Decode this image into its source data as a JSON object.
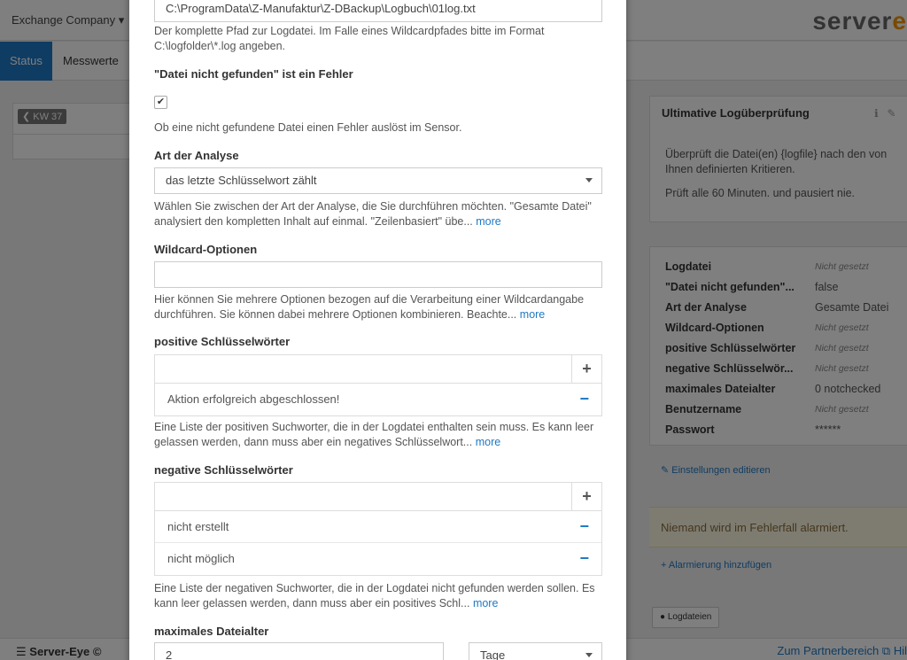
{
  "background": {
    "company_selector": "Exchange Company",
    "logo_main": "server",
    "logo_accent": "e",
    "tabs": [
      "Status",
      "Messwerte"
    ],
    "week_button": "KW 37",
    "card": {
      "title": "Ultimative Logüberprüfung",
      "description": "Überprüft die Datei(en) {logfile} nach den von Ihnen definierten Kritieren.",
      "schedule": "Prüft alle 60 Minuten. und pausiert nie."
    },
    "properties": [
      {
        "key": "Logdatei",
        "value": "Nicht gesetzt",
        "unset": true
      },
      {
        "key": "\"Datei nicht gefunden\"...",
        "value": "false",
        "unset": false
      },
      {
        "key": "Art der Analyse",
        "value": "Gesamte Datei",
        "unset": false
      },
      {
        "key": "Wildcard-Optionen",
        "value": "Nicht gesetzt",
        "unset": true
      },
      {
        "key": "positive Schlüsselwörter",
        "value": "Nicht gesetzt",
        "unset": true
      },
      {
        "key": "negative Schlüsselwör...",
        "value": "Nicht gesetzt",
        "unset": true
      },
      {
        "key": "maximales Dateialter",
        "value": "0 notchecked",
        "unset": false
      },
      {
        "key": "Benutzername",
        "value": "Nicht gesetzt",
        "unset": true
      },
      {
        "key": "Passwort",
        "value": "******",
        "unset": false
      }
    ],
    "edit_settings_link": "Einstellungen editieren",
    "alert_text": "Niemand wird im Fehlerfall alarmiert.",
    "add_alert_link": "Alarmierung hinzufügen",
    "tag_button": "Logdateien",
    "footer_brand": "Server-Eye ©",
    "footer_partner_link": "Zum Partnerbereich",
    "footer_help": "Hil"
  },
  "modal": {
    "logfile_value": "C:\\ProgramData\\Z-Manufaktur\\Z-DBackup\\Logbuch\\01log.txt",
    "logfile_help": "Der komplette Pfad zur Logdatei. Im Falle eines Wildcardpfades bitte im Format C:\\logfolder\\*.log angeben.",
    "notfound_label": "\"Datei nicht gefunden\" ist ein Fehler",
    "notfound_checked": true,
    "notfound_help": "Ob eine nicht gefundene Datei einen Fehler auslöst im Sensor.",
    "analysis_label": "Art der Analyse",
    "analysis_value": "das letzte Schlüsselwort zählt",
    "analysis_help": "Wählen Sie zwischen der Art der Analyse, die Sie durchführen möchten. \"Gesamte Datei\" analysiert den kompletten Inhalt auf einmal. \"Zeilenbasiert\" übe...",
    "wildcard_label": "Wildcard-Optionen",
    "wildcard_value": "",
    "wildcard_help": "Hier können Sie mehrere Optionen bezogen auf die Verarbeitung einer Wildcardangabe durchführen. Sie können dabei mehrere Optionen kombinieren. Beachte...",
    "positive_label": "positive Schlüsselwörter",
    "positive_items": [
      "Aktion erfolgreich abgeschlossen!"
    ],
    "positive_help": "Eine Liste der positiven Suchworter, die in der Logdatei enthalten sein muss. Es kann leer gelassen werden, dann muss aber ein negatives Schlüsselwort...",
    "negative_label": "negative Schlüsselwörter",
    "negative_items": [
      "nicht erstellt",
      "nicht möglich"
    ],
    "negative_help": "Eine Liste der negativen Suchworter, die in der Logdatei nicht gefunden werden sollen. Es kann leer gelassen werden, dann muss aber ein positives Schl...",
    "maxage_label": "maximales Dateialter",
    "maxage_value": "2",
    "maxage_unit": "Tage",
    "more_label": "more"
  }
}
